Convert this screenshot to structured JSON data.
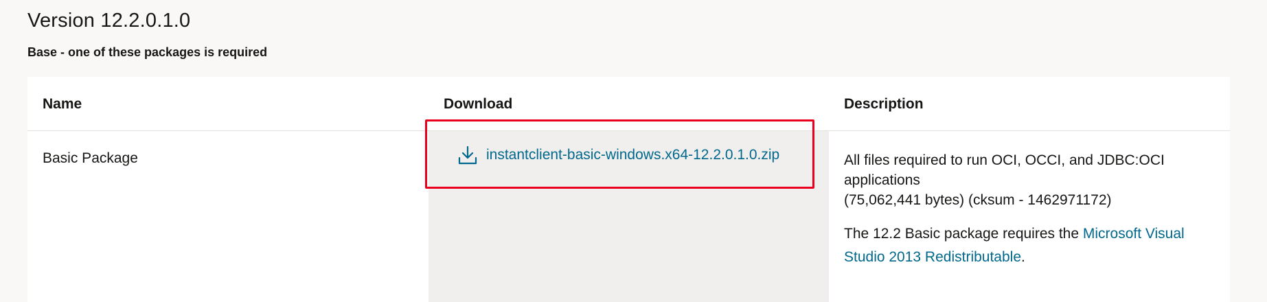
{
  "version_title": "Version 12.2.0.1.0",
  "subtitle": "Base - one of these packages is required",
  "table": {
    "headers": {
      "name": "Name",
      "download": "Download",
      "description": "Description"
    },
    "rows": [
      {
        "name": "Basic Package",
        "download_icon": "download-icon",
        "download_label": "instantclient-basic-windows.x64-12.2.0.1.0.zip",
        "description_line": "All files required to run OCI, OCCI, and JDBC:OCI applications",
        "size_info": "(75,062,441 bytes) (cksum - 1462971172)",
        "note_prefix": "The 12.2 Basic package requires the ",
        "note_link": "Microsoft Visual Studio 2013 Redistributable",
        "note_suffix": "."
      }
    ]
  },
  "colors": {
    "link": "#00688c",
    "highlight": "#e8001c",
    "download_cell_bg": "#f1efed"
  }
}
